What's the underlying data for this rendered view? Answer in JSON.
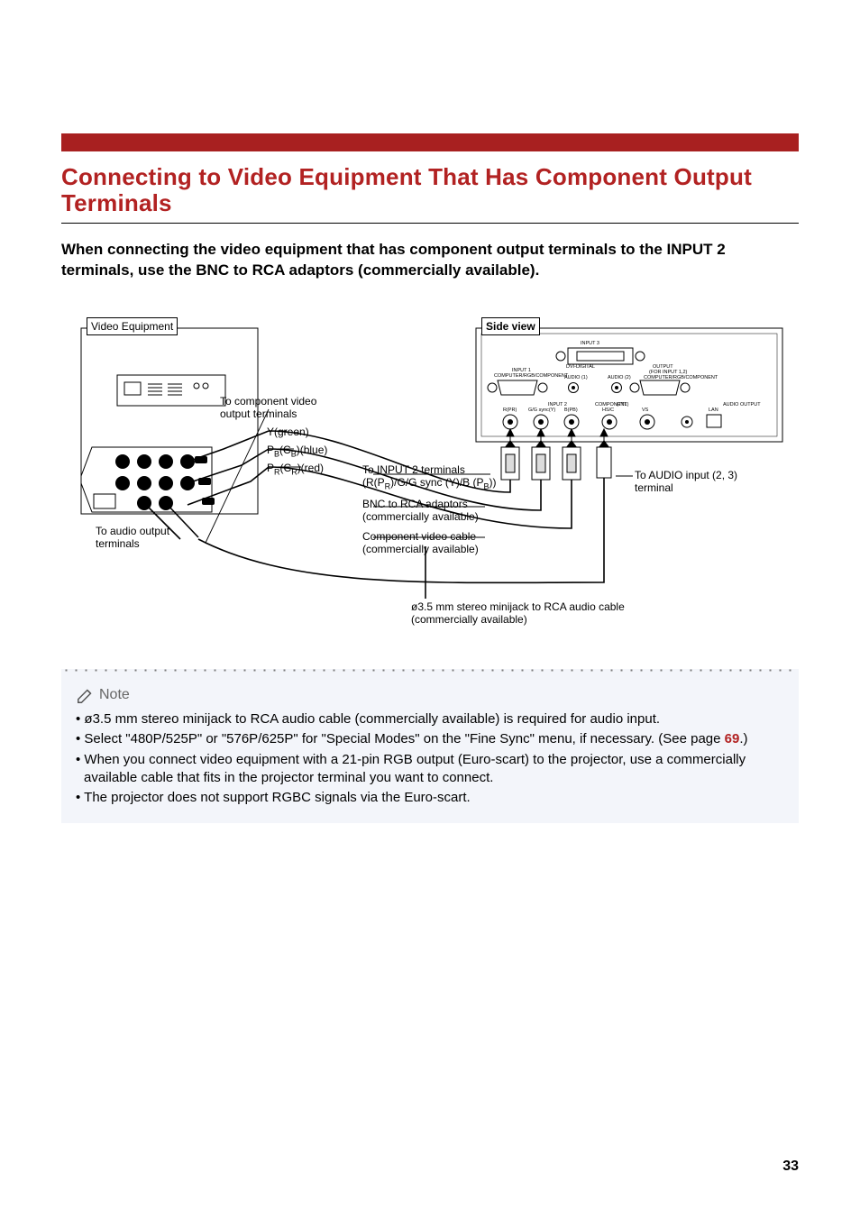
{
  "title": "Connecting to Video Equipment That Has Component Output Terminals",
  "intro": "When connecting the video equipment that has component output terminals to the INPUT 2 terminals, use the BNC to RCA adaptors (commercially available).",
  "diagram": {
    "videoEquipmentLabel": "Video Equipment",
    "sideViewLabel": "Side view",
    "toComponentVideoOutput": "To component video output terminals",
    "yGreen": "Y(green)",
    "pbBlueBefore": "P",
    "pbBlueSub": "B",
    "pbBlueMid": "(C",
    "pbBlueSub2": "B",
    "pbBlueAfter": ")(blue)",
    "prRedBefore": "P",
    "prRedSub": "R",
    "prRedMid": "(C",
    "prRedSub2": "R",
    "prRedAfter": ")(red)",
    "toInput2Before": "To INPUT 2 terminals (R(P",
    "toInput2Sub1": "R",
    "toInput2Mid": ")/G/G sync (Y)/B (P",
    "toInput2Sub2": "B",
    "toInput2After": "))",
    "bncAdaptors": "BNC to RCA adaptors (commercially available)",
    "componentCable": "Component video cable (commercially available)",
    "toAudioOutput": "To audio output terminals",
    "toAudioInput": "To AUDIO input (2, 3) terminal",
    "minijack": "ø3.5 mm stereo minijack to RCA audio cable (commercially available)",
    "panel": {
      "input3": "INPUT 3",
      "dviDigital": "DVI-DIGITAL",
      "input1": "INPUT 1",
      "computerRgbComponent": "COMPUTER/RGB/COMPONENT",
      "output": "OUTPUT",
      "forInput123": "(FOR INPUT 1,2)",
      "audio1": "AUDIO (1)",
      "audio2": "AUDIO (2)",
      "input2": "INPUT 2",
      "rPr": "R(PR)",
      "gGsync": "G/G sync(Y)",
      "bPb": "B(PB)",
      "hsc": "HS/C",
      "vs": "VS",
      "component": "COMPONENT",
      "ttl": "(TTL)",
      "audioOut": "AUDIO OUTPUT",
      "lan": "LAN"
    }
  },
  "note": {
    "heading": "Note",
    "items": [
      {
        "text": "ø3.5 mm stereo minijack to RCA audio cable (commercially available) is required for audio input."
      },
      {
        "textBefore": "Select \"480P/525P\" or \"576P/625P\" for \"Special Modes\" on the \"Fine Sync\" menu, if necessary. (See page ",
        "ref": "69",
        "textAfter": ".)"
      },
      {
        "text": "When you connect video equipment with a 21-pin RGB output (Euro-scart) to the projector, use a commercially available cable that fits in the projector terminal you want to connect."
      },
      {
        "text": "The projector  does not support RGBC signals via the Euro-scart."
      }
    ]
  },
  "pageNumber": "33"
}
